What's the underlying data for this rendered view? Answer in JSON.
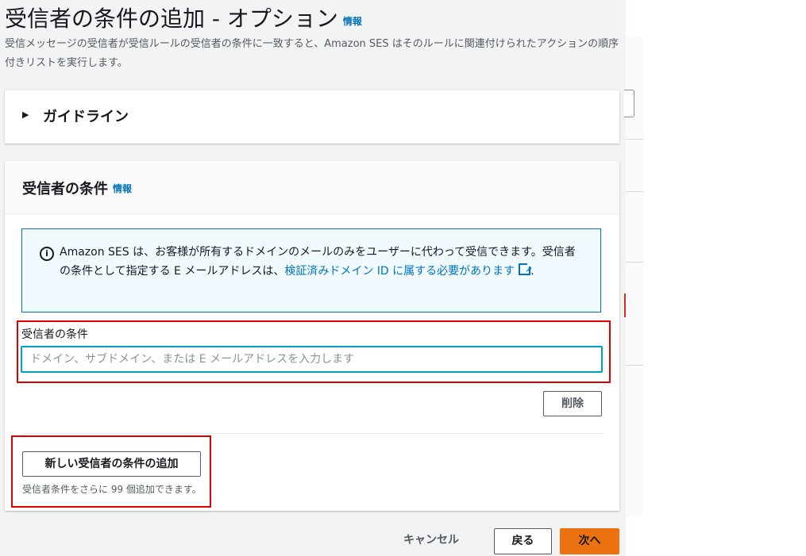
{
  "header": {
    "title": "受信者の条件の追加 - オプション",
    "info_link": "情報",
    "description": "受信メッセージの受信者が受信ルールの受信者の条件に一致すると、Amazon SES はそのルールに関連付けられたアクションの順序付きリストを実行します。"
  },
  "guidelines": {
    "label": "ガイドライン",
    "expanded": false
  },
  "recipient_conditions": {
    "title": "受信者の条件",
    "info_link": "情報",
    "alert": {
      "text": "Amazon SES は、お客様が所有するドメインのメールのみをユーザーに代わって受信できます。受信者の条件として指定する E メールアドレスは、",
      "link_text": "検証済みドメイン ID に属する必要があります",
      "suffix": "."
    },
    "field_label": "受信者の条件",
    "input_value": "",
    "input_placeholder": "ドメイン、サブドメイン、または E メールアドレスを入力します",
    "remove_button": "削除",
    "add_button": "新しい受信者の条件の追加",
    "hint": "受信者条件をさらに 99 個追加できます。"
  },
  "footer": {
    "cancel": "キャンセル",
    "back": "戻る",
    "next": "次へ"
  },
  "colors": {
    "primary_button": "#ec7211",
    "link": "#0073bb",
    "highlight": "#e00000",
    "input_focus": "#00a1c9"
  }
}
